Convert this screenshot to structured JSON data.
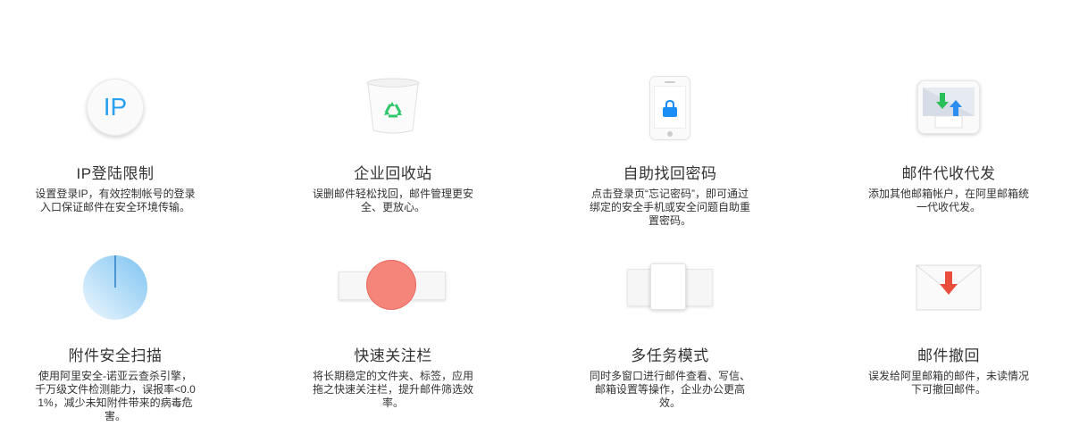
{
  "features": [
    {
      "title": "IP登陆限制",
      "desc": "设置登录IP，有效控制帐号的登录入口保证邮件在安全环境传输。",
      "icon": "ip-icon",
      "icon_text": "IP"
    },
    {
      "title": "企业回收站",
      "desc": "误删邮件轻松找回，邮件管理更安全、更放心。",
      "icon": "recycle-bin-icon"
    },
    {
      "title": "自助找回密码",
      "desc": "点击登录页“忘记密码”，即可通过绑定的安全手机或安全问题自助重置密码。",
      "icon": "phone-lock-icon"
    },
    {
      "title": "邮件代收代发",
      "desc": "添加其他邮箱帐户，在阿里邮箱统一代收代发。",
      "icon": "mail-transfer-icon"
    },
    {
      "title": "附件安全扫描",
      "desc": "使用阿里安全-诺亚云查杀引擎，千万级文件检测能力，误报率<0.01%，减少未知附件带来的病毒危害。",
      "icon": "scan-pie-icon"
    },
    {
      "title": "快速关注栏",
      "desc": "将长期稳定的文件夹、标签，应用拖之快速关注栏，提升邮件筛选效率。",
      "icon": "quick-bar-icon"
    },
    {
      "title": "多任务模式",
      "desc": "同时多窗口进行邮件查看、写信、邮箱设置等操作，企业办公更高效。",
      "icon": "multitask-icon"
    },
    {
      "title": "邮件撤回",
      "desc": "误发给阿里邮箱的邮件，未读情况下可撤回邮件。",
      "icon": "envelope-recall-icon"
    }
  ],
  "colors": {
    "ip_blue": "#2aa0f3",
    "recycle_green": "#2ec86b",
    "lock_blue": "#1a8ef5",
    "arrow_green": "#2bbf5a",
    "arrow_blue": "#2b8ef0",
    "scan_blue": "#8ccdf5",
    "dot_red": "#f5857a",
    "recall_red": "#e94e3c"
  }
}
